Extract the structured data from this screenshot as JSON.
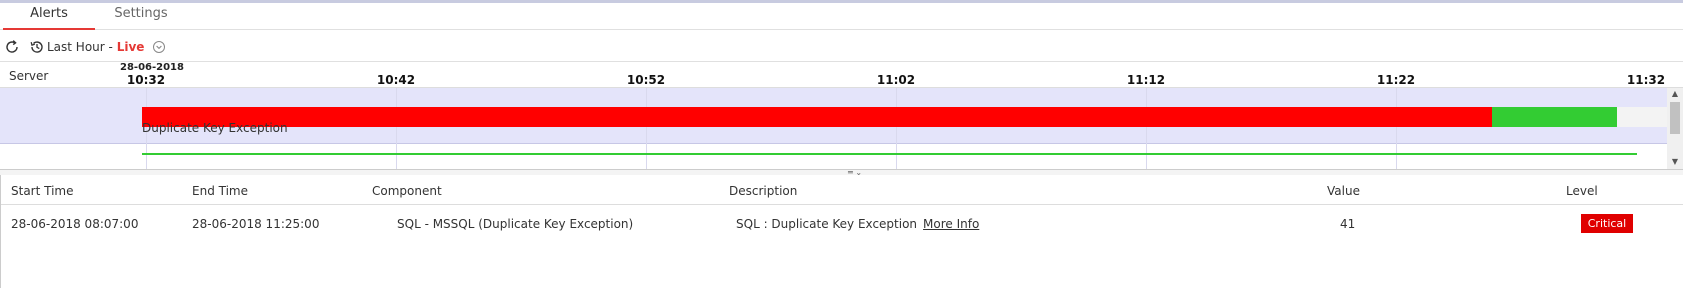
{
  "tabs": [
    {
      "label": "Alerts",
      "active": true
    },
    {
      "label": "Settings",
      "active": false
    }
  ],
  "toolbar": {
    "range_label": "Last Hour -",
    "live_label": "Live",
    "refresh_icon": "refresh-icon",
    "history_icon": "history-icon",
    "dropdown_icon": "chevron-down-circle-icon"
  },
  "timeline": {
    "server_header": "Server",
    "date": "28-06-2018",
    "ticks": [
      "10:32",
      "10:42",
      "10:52",
      "11:02",
      "11:12",
      "11:22",
      "11:32"
    ],
    "rows": [
      {
        "label": "Duplicate Key Exception",
        "segments": [
          {
            "status": "critical",
            "color": "#ff0000",
            "start": "10:32",
            "end": "11:25"
          },
          {
            "status": "ok",
            "color": "#33cc33",
            "start": "11:25",
            "end": "11:30"
          }
        ]
      }
    ]
  },
  "table": {
    "columns": [
      "Start Time",
      "End Time",
      "Component",
      "Description",
      "Value",
      "Level"
    ],
    "rows": [
      {
        "start_time": "28-06-2018 08:07:00",
        "end_time": "28-06-2018 11:25:00",
        "component": "SQL - MSSQL (Duplicate Key Exception)",
        "description": "SQL : Duplicate Key Exception",
        "more_info": "More Info",
        "value": "41",
        "level": "Critical"
      }
    ]
  },
  "colors": {
    "accent": "#e53935",
    "critical": "#ff0000",
    "ok": "#33cc33",
    "row_band": "#e4e4fa"
  }
}
